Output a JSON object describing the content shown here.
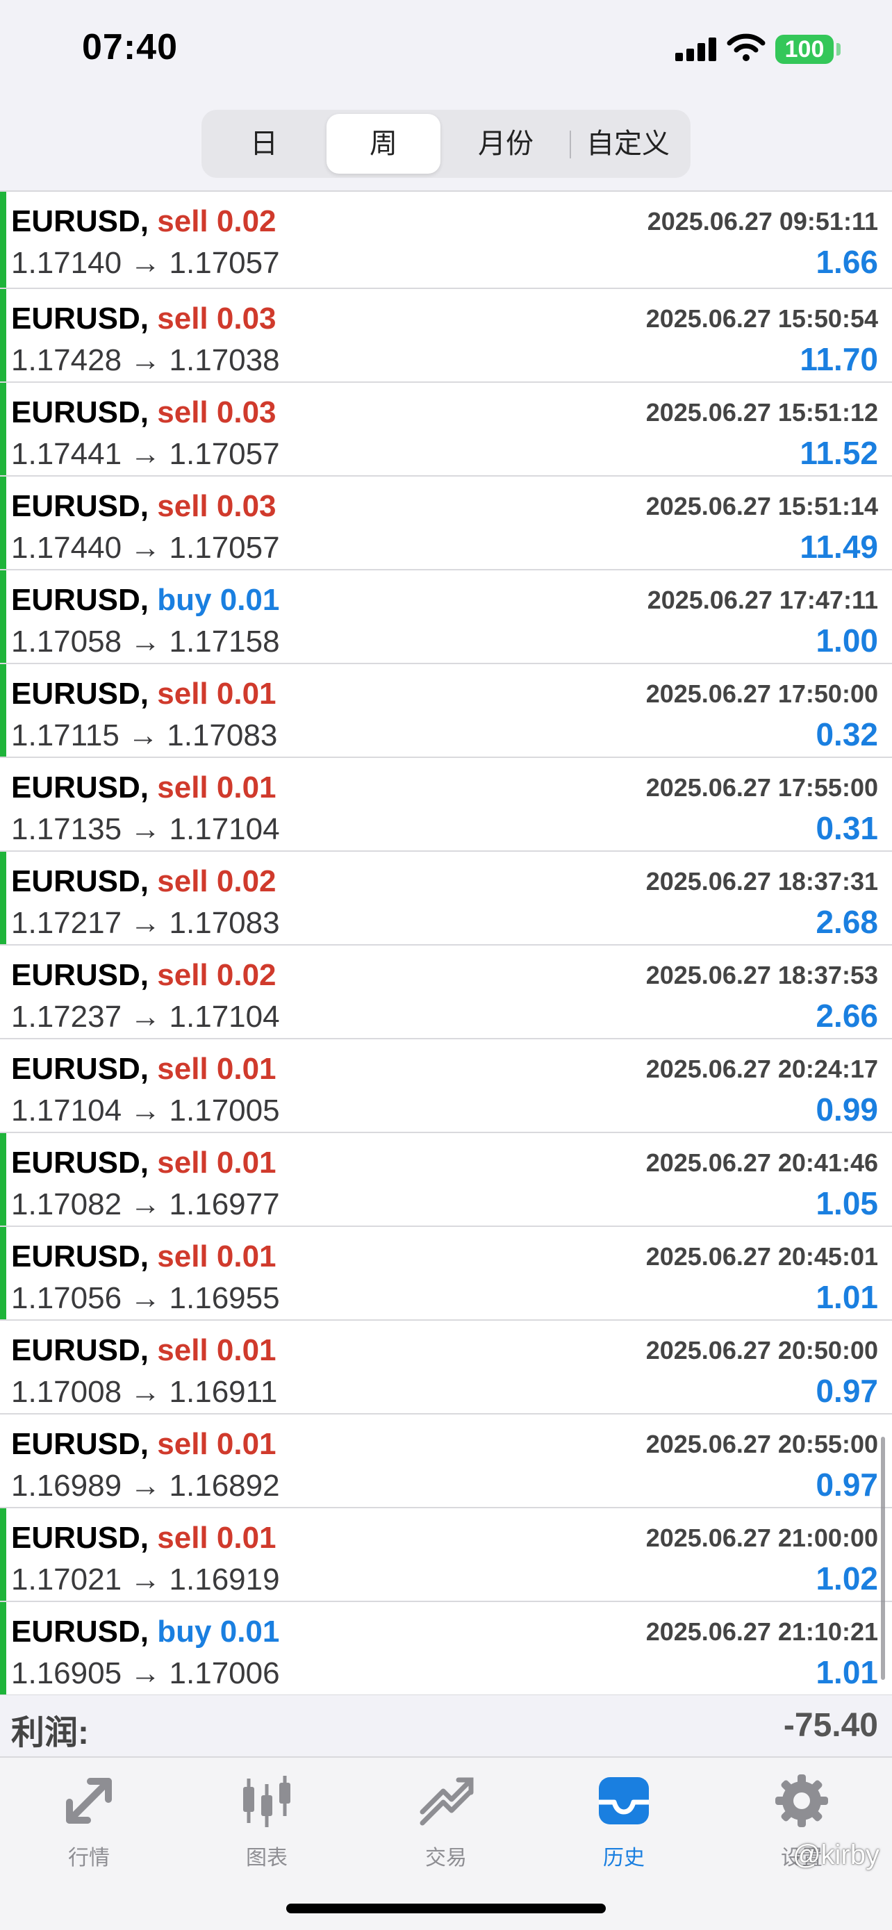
{
  "status_bar": {
    "time": "07:40",
    "battery": "100"
  },
  "segments": [
    {
      "label": "日"
    },
    {
      "label": "周"
    },
    {
      "label": "月份"
    },
    {
      "label": "自定义"
    }
  ],
  "trades": [
    {
      "symbol": "EURUSD,",
      "side": "sell",
      "volume": "0.02",
      "open": "1.17140",
      "close": "1.17057",
      "time": "2025.06.27 09:51:11",
      "profit": "1.66",
      "bar": true
    },
    {
      "symbol": "EURUSD,",
      "side": "sell",
      "volume": "0.03",
      "open": "1.17428",
      "close": "1.17038",
      "time": "2025.06.27 15:50:54",
      "profit": "11.70",
      "bar": true
    },
    {
      "symbol": "EURUSD,",
      "side": "sell",
      "volume": "0.03",
      "open": "1.17441",
      "close": "1.17057",
      "time": "2025.06.27 15:51:12",
      "profit": "11.52",
      "bar": true
    },
    {
      "symbol": "EURUSD,",
      "side": "sell",
      "volume": "0.03",
      "open": "1.17440",
      "close": "1.17057",
      "time": "2025.06.27 15:51:14",
      "profit": "11.49",
      "bar": true
    },
    {
      "symbol": "EURUSD,",
      "side": "buy",
      "volume": "0.01",
      "open": "1.17058",
      "close": "1.17158",
      "time": "2025.06.27 17:47:11",
      "profit": "1.00",
      "bar": true
    },
    {
      "symbol": "EURUSD,",
      "side": "sell",
      "volume": "0.01",
      "open": "1.17115",
      "close": "1.17083",
      "time": "2025.06.27 17:50:00",
      "profit": "0.32",
      "bar": true
    },
    {
      "symbol": "EURUSD,",
      "side": "sell",
      "volume": "0.01",
      "open": "1.17135",
      "close": "1.17104",
      "time": "2025.06.27 17:55:00",
      "profit": "0.31",
      "bar": false
    },
    {
      "symbol": "EURUSD,",
      "side": "sell",
      "volume": "0.02",
      "open": "1.17217",
      "close": "1.17083",
      "time": "2025.06.27 18:37:31",
      "profit": "2.68",
      "bar": true
    },
    {
      "symbol": "EURUSD,",
      "side": "sell",
      "volume": "0.02",
      "open": "1.17237",
      "close": "1.17104",
      "time": "2025.06.27 18:37:53",
      "profit": "2.66",
      "bar": false
    },
    {
      "symbol": "EURUSD,",
      "side": "sell",
      "volume": "0.01",
      "open": "1.17104",
      "close": "1.17005",
      "time": "2025.06.27 20:24:17",
      "profit": "0.99",
      "bar": false
    },
    {
      "symbol": "EURUSD,",
      "side": "sell",
      "volume": "0.01",
      "open": "1.17082",
      "close": "1.16977",
      "time": "2025.06.27 20:41:46",
      "profit": "1.05",
      "bar": true
    },
    {
      "symbol": "EURUSD,",
      "side": "sell",
      "volume": "0.01",
      "open": "1.17056",
      "close": "1.16955",
      "time": "2025.06.27 20:45:01",
      "profit": "1.01",
      "bar": true
    },
    {
      "symbol": "EURUSD,",
      "side": "sell",
      "volume": "0.01",
      "open": "1.17008",
      "close": "1.16911",
      "time": "2025.06.27 20:50:00",
      "profit": "0.97",
      "bar": false
    },
    {
      "symbol": "EURUSD,",
      "side": "sell",
      "volume": "0.01",
      "open": "1.16989",
      "close": "1.16892",
      "time": "2025.06.27 20:55:00",
      "profit": "0.97",
      "bar": false
    },
    {
      "symbol": "EURUSD,",
      "side": "sell",
      "volume": "0.01",
      "open": "1.17021",
      "close": "1.16919",
      "time": "2025.06.27 21:00:00",
      "profit": "1.02",
      "bar": true
    },
    {
      "symbol": "EURUSD,",
      "side": "buy",
      "volume": "0.01",
      "open": "1.16905",
      "close": "1.17006",
      "time": "2025.06.27 21:10:21",
      "profit": "1.01",
      "bar": true
    }
  ],
  "arrow": "→",
  "summary": {
    "label": "利润:",
    "value": "-75.40"
  },
  "tabs": [
    {
      "label": "行情",
      "icon": "quotes-arrows-icon"
    },
    {
      "label": "图表",
      "icon": "candlestick-chart-icon"
    },
    {
      "label": "交易",
      "icon": "trade-chart-icon"
    },
    {
      "label": "历史",
      "icon": "history-inbox-icon"
    },
    {
      "label": "设置",
      "icon": "gear-icon"
    }
  ],
  "watermark": "@kirby",
  "colors": {
    "sell": "#d03a2c",
    "buy": "#1a7fe0",
    "profit": "#1a7fe0",
    "win_bar": "#1fb43a",
    "active_tab": "#1a7fe0"
  }
}
